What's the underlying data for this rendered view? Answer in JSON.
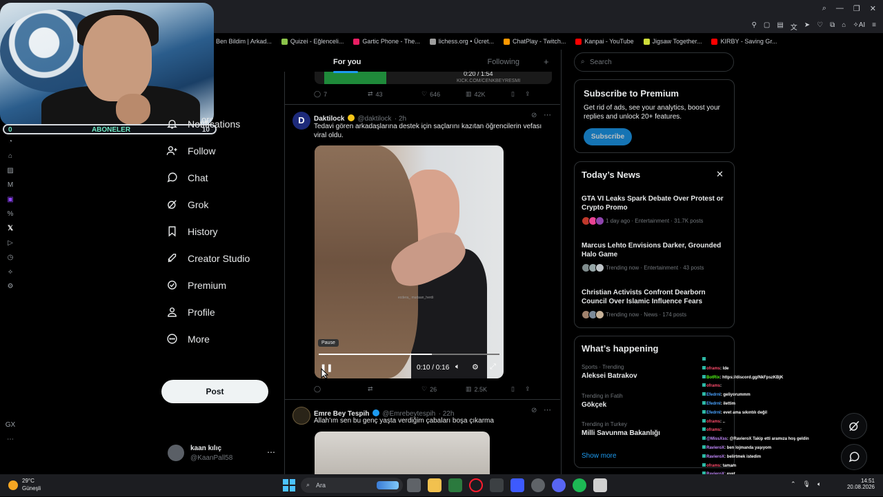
{
  "bookmarks": [
    {
      "label": "Ben Bildim | Arkad...",
      "color": "#3a7bd5"
    },
    {
      "label": "Quizei - Eğlenceli...",
      "color": "#8bc34a"
    },
    {
      "label": "Gartic Phone - The...",
      "color": "#e91e63"
    },
    {
      "label": "lichess.org • Ücret...",
      "color": "#9e9e9e"
    },
    {
      "label": "ChatPlay - Twitch...",
      "color": "#ff9800"
    },
    {
      "label": "Kanpai - YouTube",
      "color": "#ff0000"
    },
    {
      "label": "Jigsaw Together...",
      "color": "#cddc39"
    },
    {
      "label": "KIRBY - Saving Gr...",
      "color": "#ff0000"
    }
  ],
  "webcam": {
    "left_count": "0",
    "label": "ABONELER",
    "right_count": "10",
    "partial_nav_text": "ore"
  },
  "nav": [
    {
      "label": "Notifications",
      "icon": "bell-icon"
    },
    {
      "label": "Follow",
      "icon": "person-plus-icon"
    },
    {
      "label": "Chat",
      "icon": "chat-icon"
    },
    {
      "label": "Grok",
      "icon": "grok-icon"
    },
    {
      "label": "History",
      "icon": "bookmark-icon"
    },
    {
      "label": "Creator Studio",
      "icon": "rocket-icon"
    },
    {
      "label": "Premium",
      "icon": "verified-icon"
    },
    {
      "label": "Profile",
      "icon": "person-icon"
    },
    {
      "label": "More",
      "icon": "more-circle-icon"
    }
  ],
  "post_button": "Post",
  "account": {
    "name": "kaan kılıç",
    "handle": "@KaanPall58"
  },
  "tabs": {
    "for_you": "For you",
    "following": "Following",
    "plus": "+"
  },
  "prev_tweet": {
    "video_time": "0:20 / 1:54",
    "overlay_text": "KICK.COM/CENKBEYRESMI",
    "replies": "7",
    "reposts": "43",
    "likes": "646",
    "views": "42K"
  },
  "tweet1": {
    "name": "Daktilock",
    "handle": "@daktilock",
    "time": "· 2h",
    "text": "Tedavi gören arkadaşlarına destek için saçlarını kazıtan öğrencilerin vefası viral oldu.",
    "watermark": "ecdera_ mudaan_herdi",
    "pause_tip": "Pause",
    "progress": 0.625,
    "video_time": "0:10 / 0:16",
    "replies": "",
    "reposts": "",
    "likes": "26",
    "views": "2.5K"
  },
  "tweet2": {
    "name": "Emre Bey Tespih",
    "handle": "@Emrebeytespih",
    "time": "· 22h",
    "text": "Allah'ım sen bu genç yaşta verdiğim çabaları boşa çıkarma"
  },
  "search": {
    "placeholder": "Search"
  },
  "premium": {
    "title": "Subscribe to Premium",
    "text": "Get rid of ads, see your analytics, boost your replies and unlock 20+ features.",
    "button": "Subscribe"
  },
  "news": {
    "title": "Today’s News",
    "items": [
      {
        "title": "GTA VI Leaks Spark Debate Over Protest or Crypto Promo",
        "meta": "1 day ago · Entertainment · 31.7K posts"
      },
      {
        "title": "Marcus Lehto Envisions Darker, Grounded Halo Game",
        "meta": "Trending now · Entertainment · 43 posts"
      },
      {
        "title": "Christian Activists Confront Dearborn Council Over Islamic Influence Fears",
        "meta": "Trending now · News · 174 posts"
      }
    ]
  },
  "happening": {
    "title": "What’s happening",
    "items": [
      {
        "category": "Sports · Trending",
        "name": "Aleksei Batrakov"
      },
      {
        "category": "Trending in Fatih",
        "name": "Gökçek"
      },
      {
        "category": "Trending in Turkey",
        "name": "Milli Savunma Bakanlığı"
      }
    ],
    "show_more": "Show more"
  },
  "chat": [
    {
      "user": "",
      "msg": "",
      "color": "#ff4d6d"
    },
    {
      "user": "oframs",
      "msg": ": lde",
      "color": "#ff4d6d"
    },
    {
      "user": "BotRix",
      "msg": ": https://discord.gg/NkFpszKBjK",
      "color": "#53fc18"
    },
    {
      "user": "oframs",
      "msg": ":",
      "color": "#ff4d6d"
    },
    {
      "user": "Efedrnl",
      "msg": ": geliyorummm",
      "color": "#4aa3ff"
    },
    {
      "user": "Efedrnl",
      "msg": ": ilettim",
      "color": "#4aa3ff"
    },
    {
      "user": "Efedrnl",
      "msg": ": evet ama sıkıntılı değil",
      "color": "#4aa3ff"
    },
    {
      "user": "oframs",
      "msg": ": ..",
      "color": "#ff4d6d"
    },
    {
      "user": "oframs",
      "msg": ":",
      "color": "#ff4d6d"
    },
    {
      "user": "@MissXss",
      "msg": ": @RavieroX Takip etti aramıza hoş geldin",
      "color": "#c58bff"
    },
    {
      "user": "RavieroX",
      "msg": ": ben lojmanda yaşıyom",
      "color": "#c58bff"
    },
    {
      "user": "RavieroX",
      "msg": ": belirtmek istedim",
      "color": "#c58bff"
    },
    {
      "user": "oframs",
      "msg": ": tamam",
      "color": "#ff4d6d"
    },
    {
      "user": "RavieroX",
      "msg": ": evet",
      "color": "#c58bff"
    },
    {
      "user": "RavieroX",
      "msg": ": deniz manzaralı lojman",
      "color": "#c58bff"
    },
    {
      "user": "RavieroX",
      "msg": ": heybeliada",
      "color": "#c58bff"
    }
  ],
  "taskbar": {
    "temp": "29°C",
    "weather": "Güneşli",
    "search": "Ara",
    "time": "14:51",
    "date": "20.08.2026"
  },
  "colors": {
    "accent": "#1d9bf0",
    "verified": "#1d9bf0",
    "border": "#2f3336"
  }
}
